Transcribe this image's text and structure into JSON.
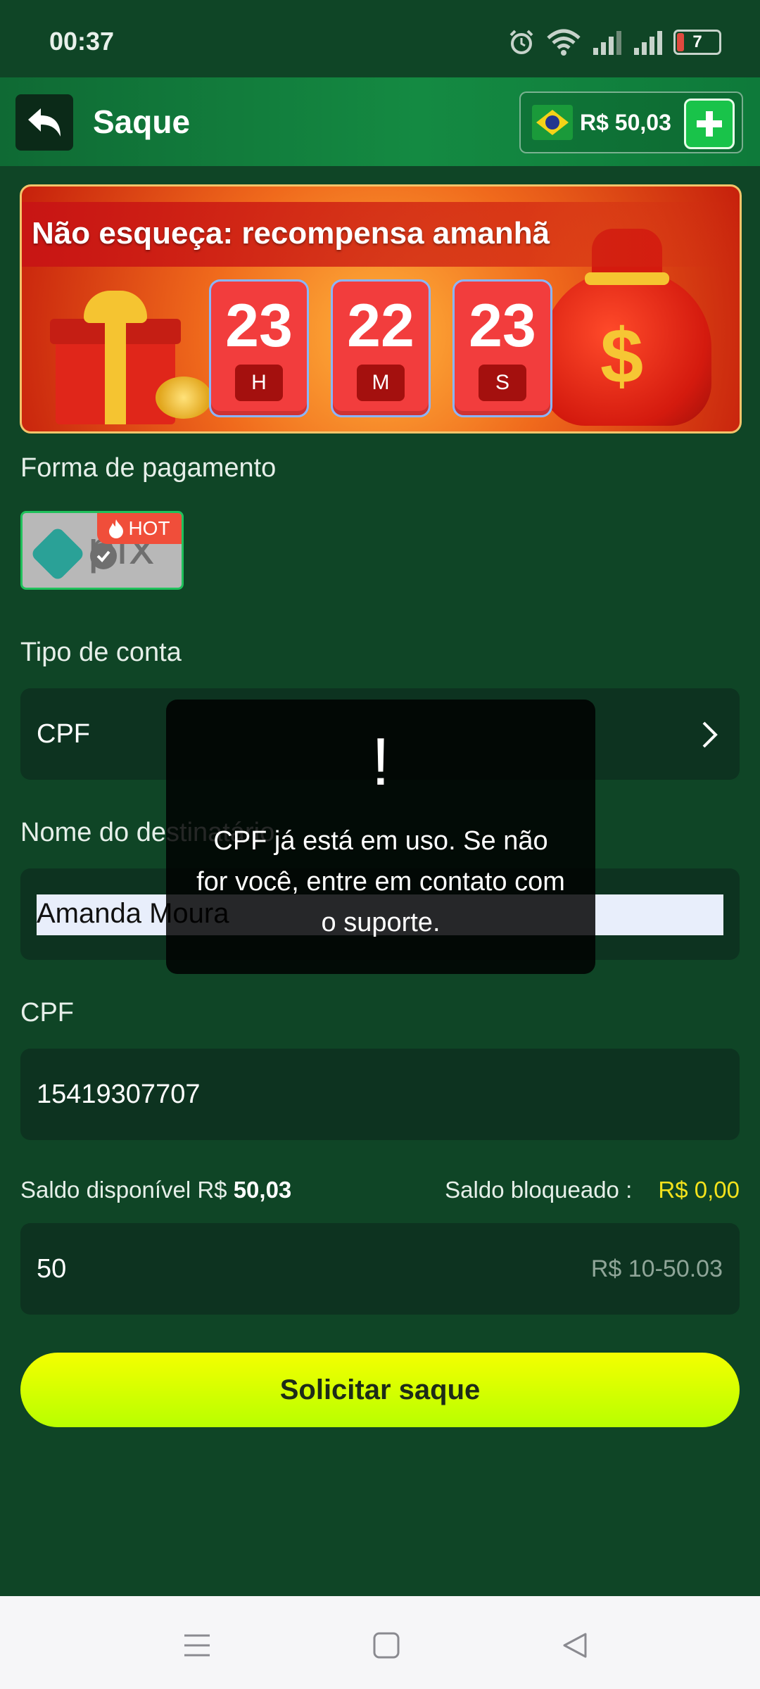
{
  "status_bar": {
    "time": "00:37",
    "battery_level": "7",
    "icons": [
      "alarm-icon",
      "wifi-icon",
      "signal-icon",
      "signal-icon",
      "battery-icon"
    ]
  },
  "header": {
    "title": "Saque",
    "balance": "R$ 50,03",
    "flag": "brazil-flag-icon"
  },
  "banner": {
    "title": "Não esqueça: recompensa amanhã",
    "timers": [
      {
        "value": "23",
        "unit": "H"
      },
      {
        "value": "22",
        "unit": "M"
      },
      {
        "value": "23",
        "unit": "S"
      }
    ]
  },
  "form": {
    "payment_label": "Forma de pagamento",
    "payment_option": "PIX",
    "hot_label": "HOT",
    "account_type_label": "Tipo de conta",
    "account_type_value": "CPF",
    "recipient_label": "Nome do destinatário",
    "recipient_value": "Amanda Moura",
    "cpf_label": "CPF",
    "cpf_value": "15419307707",
    "available_label": "Saldo disponível R$",
    "available_value": "50,03",
    "locked_label": "Saldo bloqueado :",
    "locked_value": "R$ 0,00",
    "amount_value": "50",
    "amount_range": "R$ 10-50.03",
    "submit_label": "Solicitar saque"
  },
  "toast": {
    "mark": "!",
    "message": "CPF já está em uso. Se não for você, entre em contato com o suporte."
  },
  "colors": {
    "background": "#0f4526",
    "accent_green": "#1fc15b",
    "button_yellow": "#f4ff00",
    "locked_yellow": "#f4e21c"
  }
}
